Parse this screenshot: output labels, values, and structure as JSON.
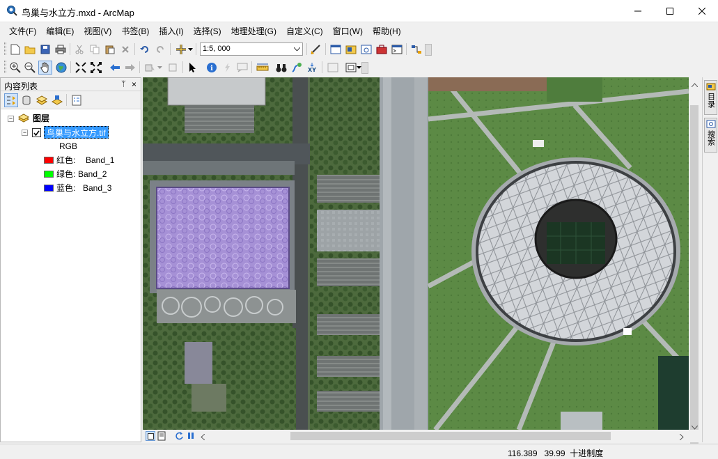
{
  "window": {
    "title": "鸟巢与水立方.mxd - ArcMap"
  },
  "menu": [
    "文件(F)",
    "编辑(E)",
    "视图(V)",
    "书签(B)",
    "插入(I)",
    "选择(S)",
    "地理处理(G)",
    "自定义(C)",
    "窗口(W)",
    "帮助(H)"
  ],
  "toolbar": {
    "scale": "1:5, 000"
  },
  "toc": {
    "title": "内容列表",
    "pin": "ᛘ",
    "close": "×",
    "group_label": "图层",
    "layer_name": "鸟巢与水立方.tif",
    "layer_checked": true,
    "render_label": "RGB",
    "bands": [
      {
        "label": "红色:",
        "band": "Band_1",
        "color": "#ff0000"
      },
      {
        "label": "绿色:",
        "band": "Band_2",
        "color": "#00ff00"
      },
      {
        "label": "蓝色:",
        "band": "Band_3",
        "color": "#0000ff"
      }
    ]
  },
  "right_dock": {
    "catalog": "目录",
    "search": "搜索"
  },
  "status": {
    "x": "116.389",
    "y": "39.99",
    "units": "十进制度"
  }
}
